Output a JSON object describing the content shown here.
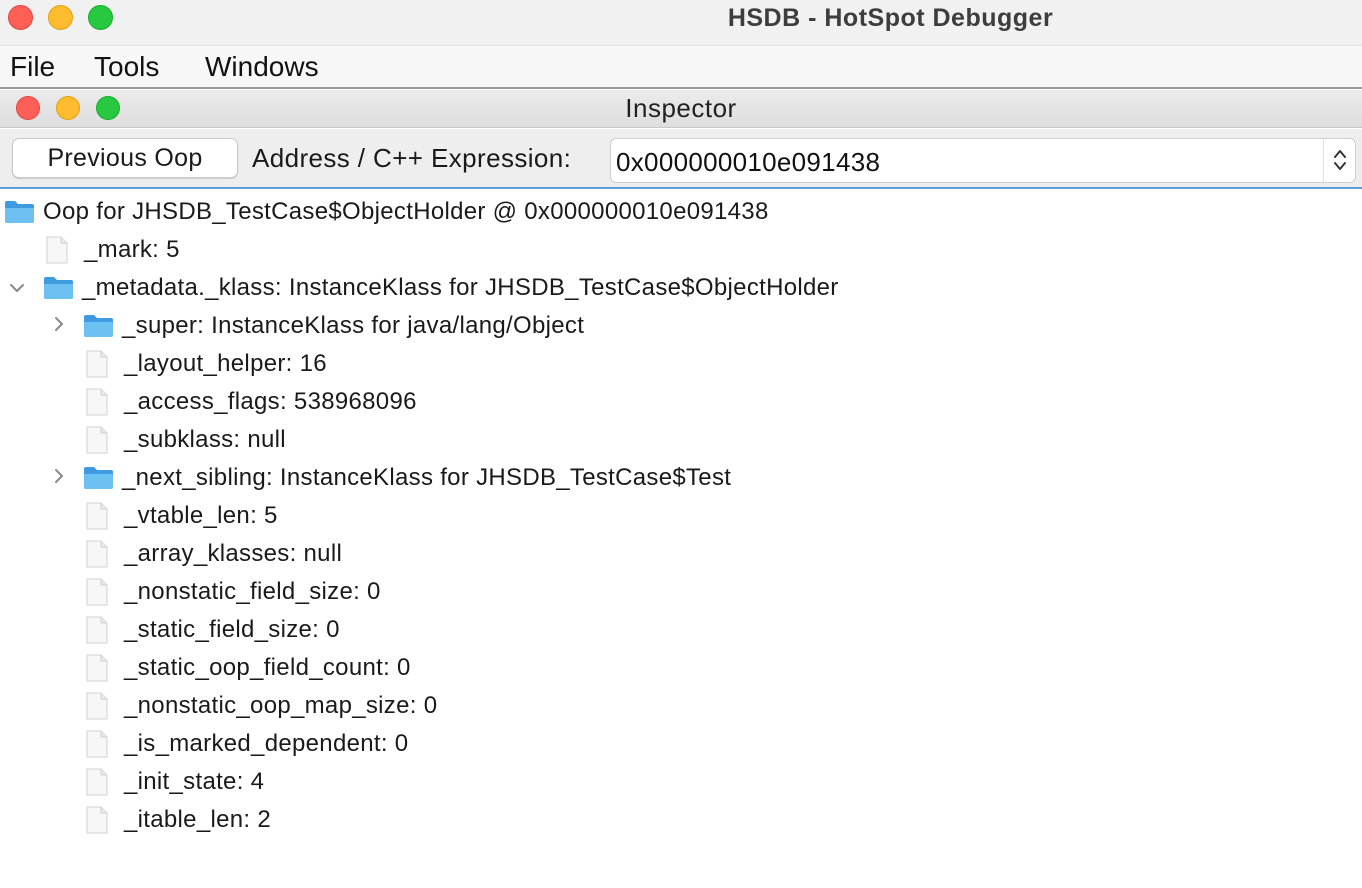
{
  "window": {
    "title": "HSDB - HotSpot Debugger"
  },
  "menubar": {
    "items": [
      "File",
      "Tools",
      "Windows"
    ]
  },
  "inspector": {
    "title": "Inspector",
    "previous_oop_label": "Previous Oop",
    "address_label": "Address / C++ Expression:",
    "address_value": "0x000000010e091438"
  },
  "tree": {
    "root": "Oop for JHSDB_TestCase$ObjectHolder @ 0x000000010e091438",
    "mark": "_mark: 5",
    "metadata": "_metadata._klass: InstanceKlass for JHSDB_TestCase$ObjectHolder",
    "children": [
      {
        "label": "_super: InstanceKlass for java/lang/Object",
        "kind": "folder",
        "expander": "collapsed"
      },
      {
        "label": "_layout_helper: 16",
        "kind": "leaf"
      },
      {
        "label": "_access_flags: 538968096",
        "kind": "leaf"
      },
      {
        "label": "_subklass: null",
        "kind": "leaf"
      },
      {
        "label": "_next_sibling: InstanceKlass for JHSDB_TestCase$Test",
        "kind": "folder",
        "expander": "collapsed"
      },
      {
        "label": "_vtable_len: 5",
        "kind": "leaf"
      },
      {
        "label": "_array_klasses: null",
        "kind": "leaf"
      },
      {
        "label": "_nonstatic_field_size: 0",
        "kind": "leaf"
      },
      {
        "label": "_static_field_size: 0",
        "kind": "leaf"
      },
      {
        "label": "_static_oop_field_count: 0",
        "kind": "leaf"
      },
      {
        "label": "_nonstatic_oop_map_size: 0",
        "kind": "leaf"
      },
      {
        "label": "_is_marked_dependent: 0",
        "kind": "leaf"
      },
      {
        "label": "_init_state: 4",
        "kind": "leaf"
      },
      {
        "label": "_itable_len: 2",
        "kind": "leaf"
      }
    ]
  },
  "colors": {
    "folder": "#5cb3ec",
    "selection_border": "#5a9fd6",
    "close": "#fe5f57",
    "minimize": "#febc2e",
    "zoom": "#28c840"
  }
}
